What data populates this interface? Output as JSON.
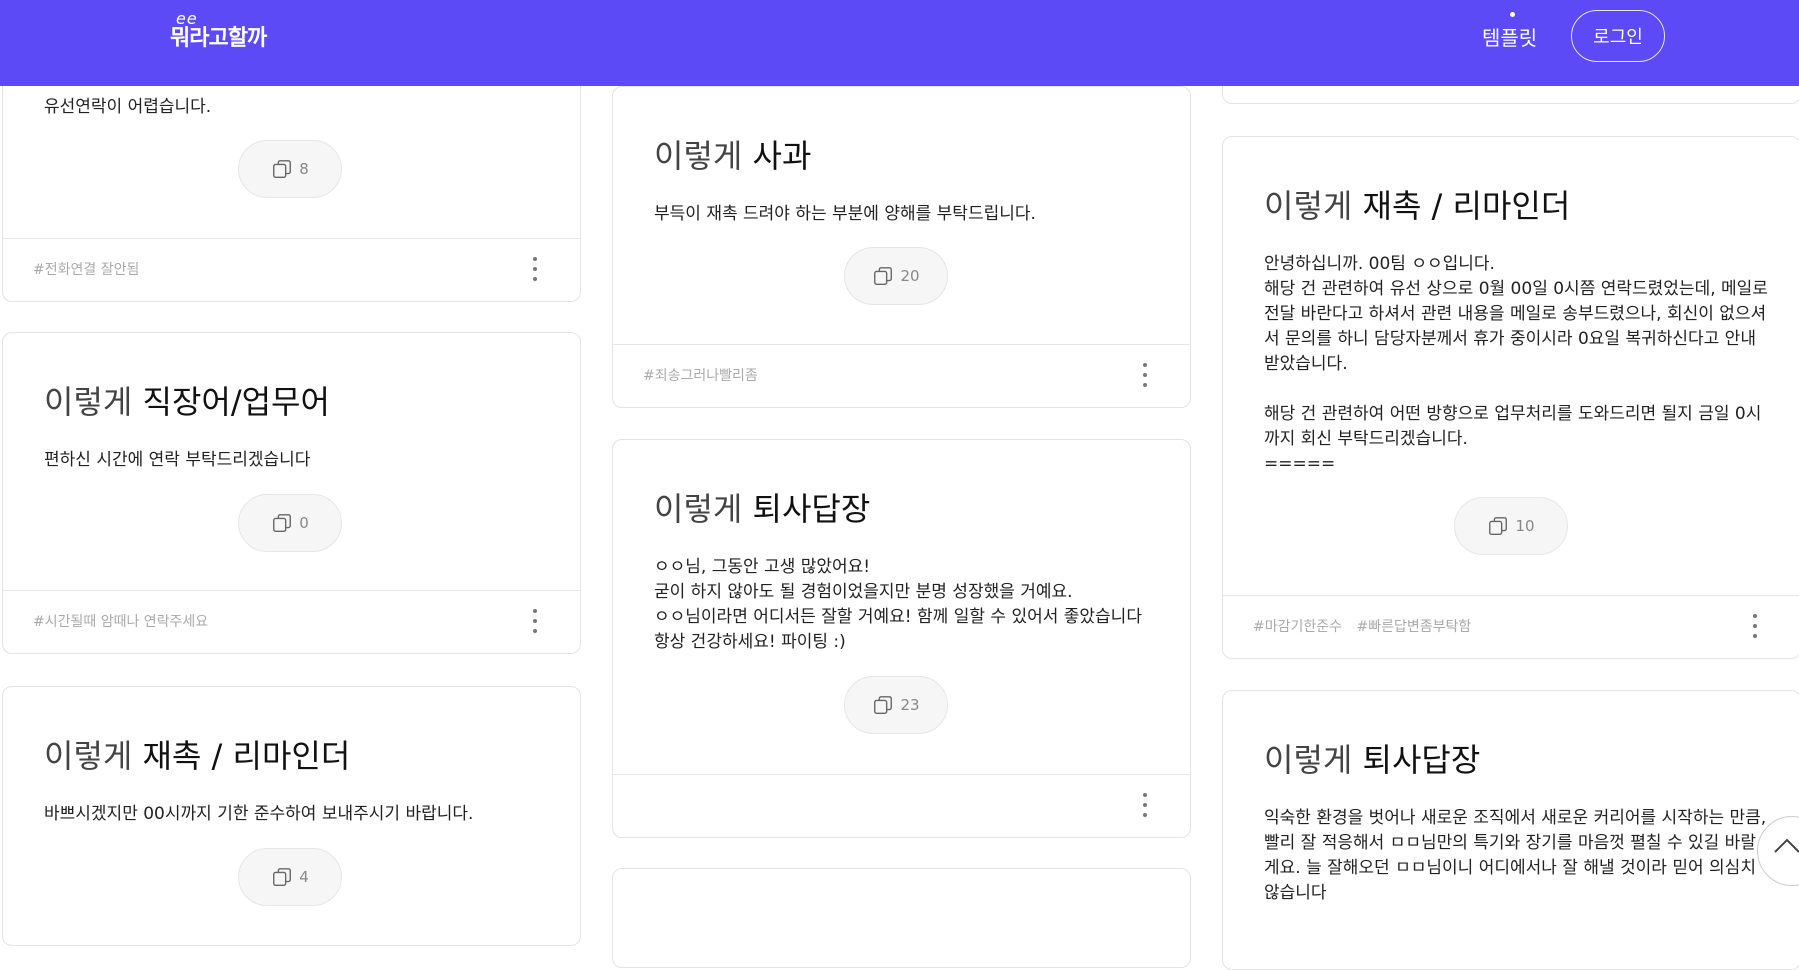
{
  "header": {
    "logo_swash": "ee",
    "logo_text": "뭐라고할까",
    "nav_template": "템플릿",
    "login": "로그인"
  },
  "cards": [
    {
      "id": "c1",
      "body": "유선연락이 어렵습니다.",
      "copy_count": "8",
      "tags": [
        "#전화연결 잘안됨"
      ]
    },
    {
      "id": "c2",
      "title_prefix": "이렇게",
      "title_keyword": "직장어/업무어",
      "body": "편하신 시간에 연락 부탁드리겠습니다",
      "copy_count": "0",
      "tags": [
        "#시간될때 암때나 연락주세요"
      ]
    },
    {
      "id": "c3",
      "title_prefix": "이렇게",
      "title_keyword": "재촉 / 리마인더",
      "body": "바쁘시겠지만 00시까지 기한 준수하여 보내주시기 바랍니다.",
      "copy_count": "4"
    },
    {
      "id": "c4",
      "title_prefix": "이렇게",
      "title_keyword": "사과",
      "body": "부득이 재촉 드려야 하는 부분에 양해를 부탁드립니다.",
      "copy_count": "20",
      "tags": [
        "#죄송그러나빨리좀"
      ]
    },
    {
      "id": "c5",
      "title_prefix": "이렇게",
      "title_keyword": "퇴사답장",
      "body": "ㅇㅇ님, 그동안 고생 많았어요!\n굳이 하지 않아도 될 경험이었을지만 분명 성장했을 거예요.\nㅇㅇ님이라면 어디서든 잘할 거예요! 함께 일할 수 있어서 좋았습니다 항상 건강하세요! 파이팅 :)",
      "copy_count": "23",
      "tags": []
    },
    {
      "id": "c6",
      "title_prefix": "이렇게",
      "title_keyword": "재촉 / 리마인더",
      "body": "안녕하십니까. 00팀 ㅇㅇ입니다.\n해당 건 관련하여 유선 상으로 0월 00일 0시쯤 연락드렸었는데, 메일로 전달 바란다고 하셔서 관련 내용을 메일로 송부드렸으나, 회신이 없으셔서 문의를 하니 담당자분께서 휴가 중이시라 0요일 복귀하신다고 안내받았습니다.\n\n해당 건 관련하여 어떤 방향으로 업무처리를 도와드리면 될지 금일 0시까지 회신 부탁드리겠습니다.\n=====",
      "copy_count": "10",
      "tags": [
        "#마감기한준수",
        "#빠른답변좀부탁함"
      ]
    },
    {
      "id": "c7",
      "title_prefix": "이렇게",
      "title_keyword": "퇴사답장",
      "body": "익숙한 환경을 벗어나 새로운 조직에서 새로운 커리어를 시작하는 만큼, 빨리 잘 적응해서 ㅁㅁ님만의 특기와 장기를 마음껏 펼칠 수 있길 바랄게요. 늘 잘해오던 ㅁㅁ님이니 어디에서나 잘 해낼 것이라 믿어 의심치 않습니다"
    }
  ],
  "icons": {
    "copy": "copy-icon",
    "more": "more-vertical-icon",
    "scroll_top": "chevron-up-icon"
  },
  "colors": {
    "header_bg": "#5b4af5",
    "card_border": "#e3e3e3",
    "tag_text": "#aaaaaa"
  }
}
